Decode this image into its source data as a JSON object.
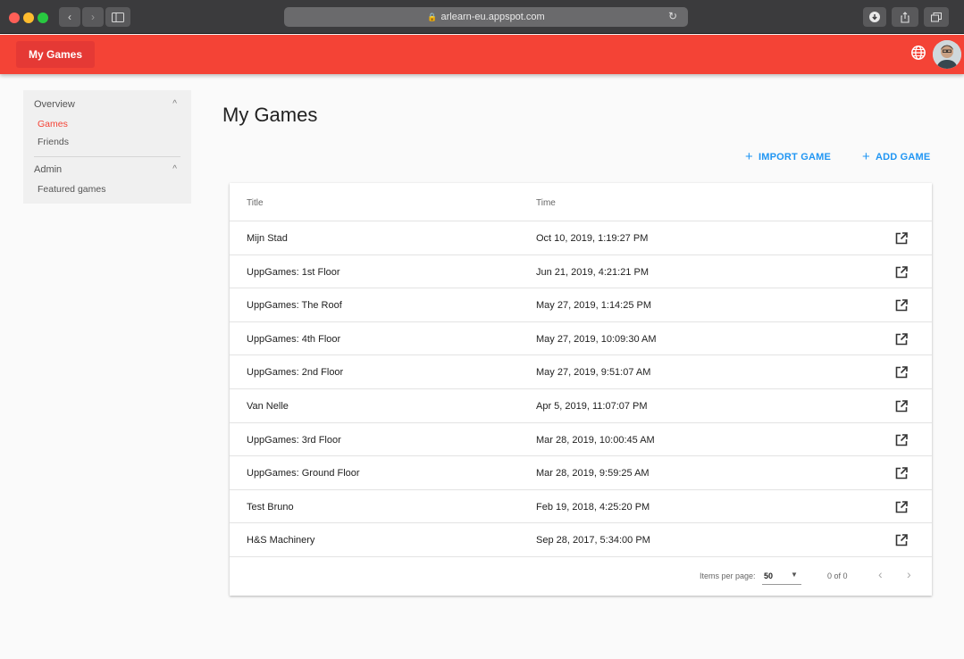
{
  "browser": {
    "url": "arlearn-eu.appspot.com"
  },
  "appbar": {
    "title": "My Games",
    "accent": "#f44336"
  },
  "sidebar": {
    "sections": [
      {
        "label": "Overview",
        "items": [
          {
            "label": "Games",
            "active": true
          },
          {
            "label": "Friends",
            "active": false
          }
        ]
      },
      {
        "label": "Admin",
        "items": [
          {
            "label": "Featured games",
            "active": false
          }
        ]
      }
    ]
  },
  "main": {
    "title": "My Games",
    "import_label": "IMPORT GAME",
    "add_label": "ADD GAME",
    "action_color": "#2196f3"
  },
  "table": {
    "columns": [
      "Title",
      "Time"
    ],
    "rows": [
      {
        "title": "Mijn Stad",
        "time": "Oct 10, 2019, 1:19:27 PM"
      },
      {
        "title": "UppGames: 1st Floor",
        "time": "Jun 21, 2019, 4:21:21 PM"
      },
      {
        "title": "UppGames: The Roof",
        "time": "May 27, 2019, 1:14:25 PM"
      },
      {
        "title": "UppGames: 4th Floor",
        "time": "May 27, 2019, 10:09:30 AM"
      },
      {
        "title": "UppGames: 2nd Floor",
        "time": "May 27, 2019, 9:51:07 AM"
      },
      {
        "title": "Van Nelle",
        "time": "Apr 5, 2019, 11:07:07 PM"
      },
      {
        "title": "UppGames: 3rd Floor",
        "time": "Mar 28, 2019, 10:00:45 AM"
      },
      {
        "title": "UppGames: Ground Floor",
        "time": "Mar 28, 2019, 9:59:25 AM"
      },
      {
        "title": "Test Bruno",
        "time": "Feb 19, 2018, 4:25:20 PM"
      },
      {
        "title": "H&S Machinery",
        "time": "Sep 28, 2017, 5:34:00 PM"
      }
    ]
  },
  "paginator": {
    "items_label": "Items per page:",
    "page_size": "50",
    "range": "0 of 0"
  }
}
